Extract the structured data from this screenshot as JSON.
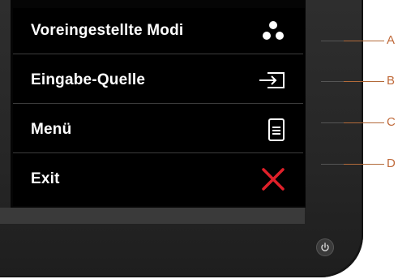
{
  "osd_menu": {
    "items": [
      {
        "label": "Voreingestellte  Modi",
        "icon": "three-dots-icon"
      },
      {
        "label": "Eingabe-Quelle",
        "icon": "input-source-icon"
      },
      {
        "label": "Menü",
        "icon": "menu-document-icon"
      },
      {
        "label": "Exit",
        "icon": "close-icon"
      }
    ]
  },
  "callouts": {
    "a": "A",
    "b": "B",
    "c": "C",
    "d": "D"
  },
  "colors": {
    "osd_background": "#000000",
    "osd_text": "#ffffff",
    "exit_icon": "#e0202a",
    "callout_line": "#c06a3a",
    "bezel": "#2b2b2b"
  },
  "power_button": {
    "icon": "power-icon"
  }
}
